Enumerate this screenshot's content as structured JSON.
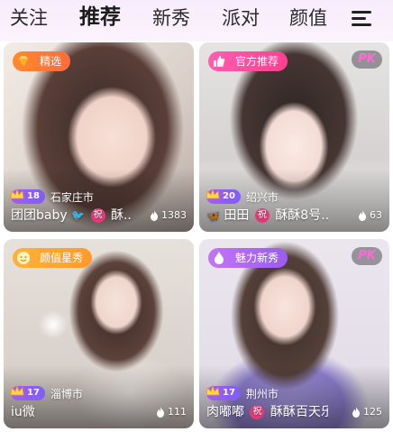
{
  "tabs": [
    "关注",
    "推荐",
    "新秀",
    "派对",
    "颜值"
  ],
  "active_tab": "推荐",
  "cards": [
    {
      "badge": "精选",
      "badge_color": "#ff7a30",
      "badge_icon": "diamond-icon",
      "show_pk": false,
      "level": "18",
      "location": "石家庄市",
      "name": "团团baby",
      "name_suffix": "酥...",
      "heat": "1383"
    },
    {
      "badge": "官方推荐",
      "badge_color": "#ff4fa8",
      "badge_icon": "thumb-up-icon",
      "show_pk": true,
      "pk_label": "PK",
      "level": "20",
      "location": "绍兴市",
      "name": "田田",
      "name_suffix": "酥酥8号...",
      "heat": "63"
    },
    {
      "badge": "颜值星秀",
      "badge_color": "#ffab2e",
      "badge_icon": "star-face-icon",
      "show_pk": false,
      "level": "17",
      "location": "淄博市",
      "name": "iu微",
      "name_suffix": "",
      "heat": "111"
    },
    {
      "badge": "魅力新秀",
      "badge_color": "#b267f0",
      "badge_icon": "drop-icon",
      "show_pk": true,
      "pk_label": "PK",
      "level": "17",
      "location": "荆州市",
      "name": "肉嘟嘟",
      "name_suffix": "酥酥百天乐",
      "heat": "125"
    }
  ],
  "zhu_char": "祝",
  "colors": {
    "level_badge": "#9a5cf6",
    "zhu": "#e23a7a",
    "pk_text": "#ff6ad5"
  }
}
